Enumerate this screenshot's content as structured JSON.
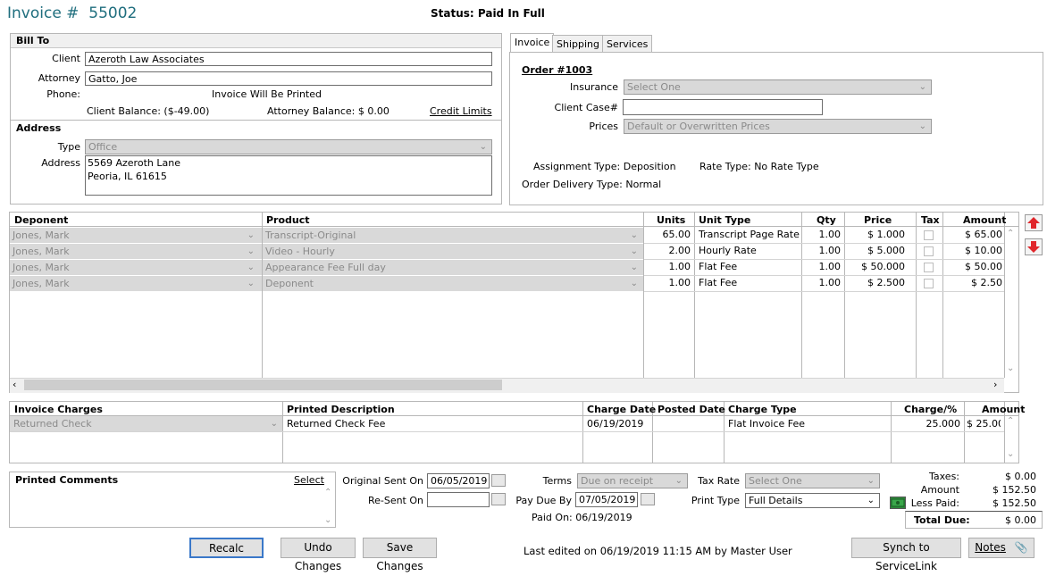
{
  "header": {
    "invoice_label": "Invoice #",
    "invoice_number": "55002",
    "status": "Status: Paid In Full"
  },
  "bill_to": {
    "section_title": "Bill To",
    "client_label": "Client",
    "client_value": "Azeroth Law Associates",
    "attorney_label": "Attorney",
    "attorney_value": "Gatto, Joe",
    "phone_label": "Phone:",
    "print_note": "Invoice Will Be Printed",
    "client_balance": "Client Balance:  ($-49.00)",
    "attorney_balance": "Attorney Balance:  $ 0.00",
    "credit_limits_link": "Credit Limits"
  },
  "address": {
    "section_title": "Address",
    "type_label": "Type",
    "type_value": "Office",
    "address_label": "Address",
    "line1": "5569 Azeroth Lane",
    "line2": "Peoria, IL 61615"
  },
  "tabs": [
    {
      "label": "Invoice"
    },
    {
      "label": "Shipping"
    },
    {
      "label": "Services"
    }
  ],
  "order": {
    "order_link": "Order #1003",
    "insurance_label": "Insurance",
    "insurance_value": "Select One",
    "client_case_label": "Client Case#",
    "client_case_value": "",
    "prices_label": "Prices",
    "prices_value": "Default or Overwritten Prices",
    "assignment_type": "Assignment Type:  Deposition",
    "rate_type": "Rate Type:  No Rate Type",
    "order_delivery_type": "Order Delivery Type:  Normal"
  },
  "services_table": {
    "columns": [
      "Deponent",
      "Product",
      "Units",
      "Unit Type",
      "Qty",
      "Price",
      "Tax",
      "Amount"
    ],
    "rows": [
      {
        "deponent": "Jones, Mark",
        "product": "Transcript-Original",
        "units": "65.00",
        "unit_type": "Transcript Page Rate",
        "qty": "1.00",
        "price": "$ 1.000",
        "amount": "$ 65.00"
      },
      {
        "deponent": "Jones, Mark",
        "product": "Video - Hourly",
        "units": "2.00",
        "unit_type": "Hourly Rate",
        "qty": "1.00",
        "price": "$ 5.000",
        "amount": "$ 10.00"
      },
      {
        "deponent": "Jones, Mark",
        "product": "Appearance Fee Full day",
        "units": "1.00",
        "unit_type": "Flat Fee",
        "qty": "1.00",
        "price": "$ 50.000",
        "amount": "$ 50.00"
      },
      {
        "deponent": "Jones, Mark",
        "product": "Deponent",
        "units": "1.00",
        "unit_type": "Flat Fee",
        "qty": "1.00",
        "price": "$ 2.500",
        "amount": "$ 2.50"
      }
    ]
  },
  "charges_table": {
    "columns": [
      "Invoice Charges",
      "Printed Description",
      "Charge Date",
      "Posted Date",
      "Charge Type",
      "Charge/%",
      "Amount"
    ],
    "rows": [
      {
        "charge": "Returned Check",
        "description": "Returned Check Fee",
        "charge_date": "06/19/2019",
        "posted_date": "",
        "charge_type": "Flat Invoice Fee",
        "charge_pct": "25.000",
        "amount": "$ 25.00"
      }
    ]
  },
  "comments": {
    "label": "Printed Comments",
    "select_link": "Select"
  },
  "dates": {
    "original_sent_label": "Original Sent On",
    "original_sent_value": "06/05/2019",
    "resent_label": "Re-Sent On",
    "resent_value": "",
    "terms_label": "Terms",
    "terms_value": "Due on receipt",
    "pay_due_label": "Pay Due By",
    "pay_due_value": "07/05/2019",
    "paid_on": "Paid On:  06/19/2019",
    "tax_rate_label": "Tax Rate",
    "tax_rate_value": "Select One",
    "print_type_label": "Print Type",
    "print_type_value": "Full Details"
  },
  "totals": {
    "taxes_label": "Taxes:",
    "taxes_value": "$ 0.00",
    "amount_label": "Amount",
    "amount_value": "$ 152.50",
    "less_paid_label": "Less Paid:",
    "less_paid_value": "$ 152.50",
    "total_due_label": "Total Due:",
    "total_due_value": "$ 0.00"
  },
  "footer": {
    "recalc": "Recalc",
    "undo": "Undo Changes",
    "save": "Save Changes",
    "last_edited": "Last edited on 06/19/2019 11:15 AM by Master User",
    "synch": "Synch to ServiceLink",
    "notes": "Notes"
  },
  "colors": {
    "title": "#1f6e7e",
    "disabled_bg": "#d9d9d9",
    "arrow_red": "#e0262b",
    "money_green": "#2e8b3a"
  }
}
